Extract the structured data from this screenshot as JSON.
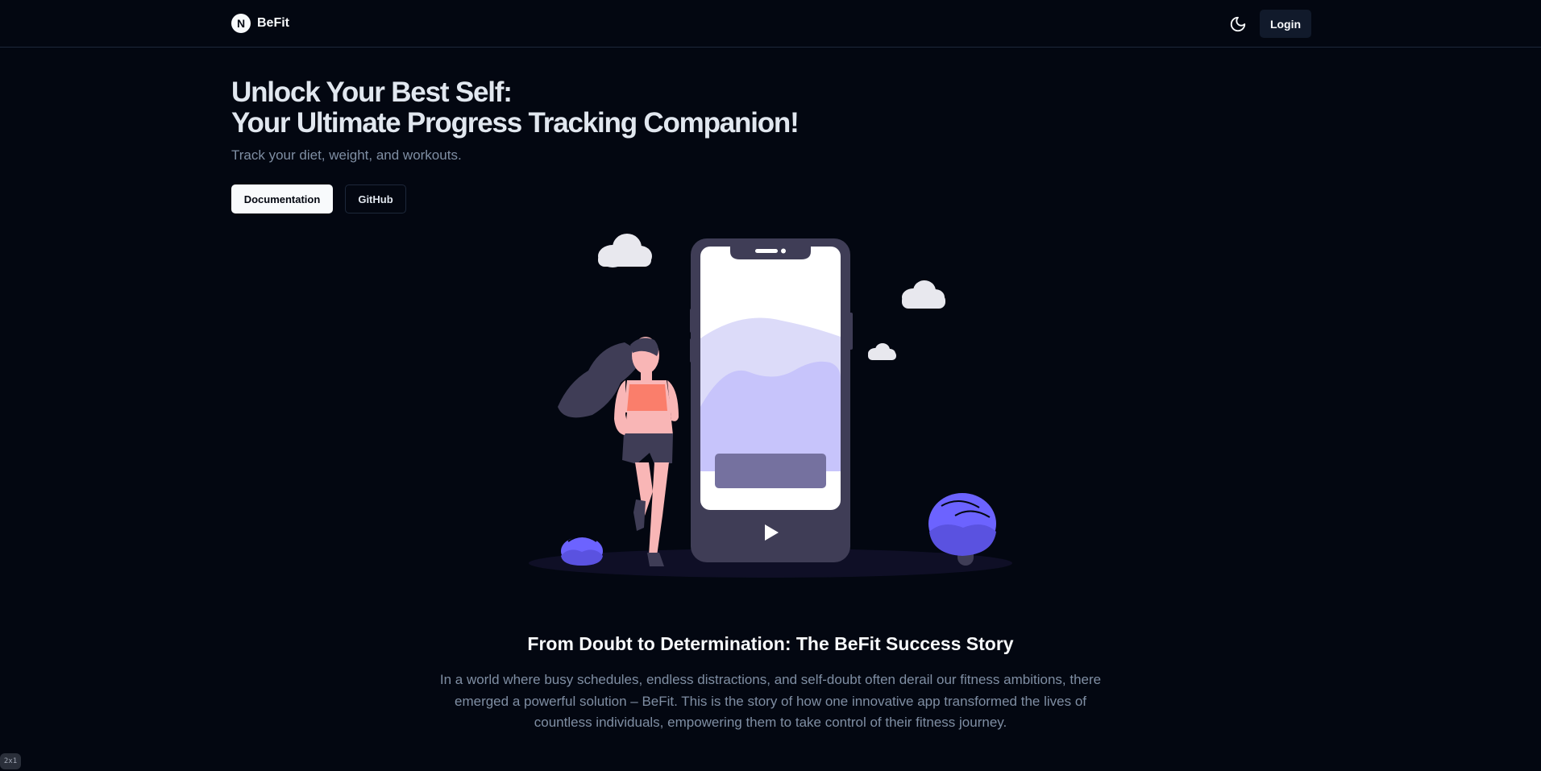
{
  "header": {
    "logo_letter": "N",
    "brand_name": "BeFit",
    "theme_toggle_icon": "moon-icon",
    "login_label": "Login"
  },
  "hero": {
    "title_line1": "Unlock Your Best Self:",
    "title_line2": "Your Ultimate Progress Tracking Companion!",
    "subtitle": "Track your diet, weight, and workouts.",
    "documentation_label": "Documentation",
    "github_label": "GitHub"
  },
  "story": {
    "title": "From Doubt to Determination: The BeFit Success Story",
    "text": "In a world where busy schedules, endless distractions, and self-doubt often derail our fitness ambitions, there emerged a powerful solution – BeFit. This is the story of how one innovative app transformed the lives of countless individuals, empowering them to take control of their fitness journey."
  },
  "badge": "2x1",
  "colors": {
    "background": "#030711",
    "accent": "#6c63ff",
    "phone_body": "#3f3d56"
  }
}
